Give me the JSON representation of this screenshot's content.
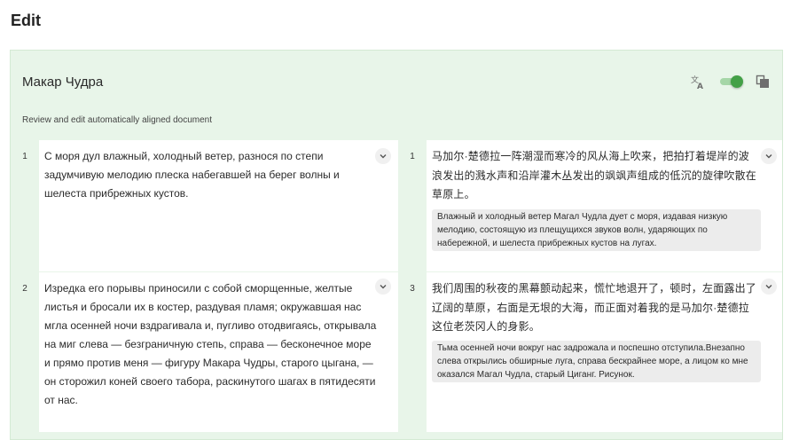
{
  "page": {
    "title": "Edit"
  },
  "document": {
    "title": "Макар Чудра",
    "subtitle": "Review and edit automatically aligned document"
  },
  "toolbar": {
    "translate_icon": "translate-icon",
    "toggle_state": "on",
    "copy_icon": "copy-icon",
    "accent_color": "#43a047"
  },
  "rows": [
    {
      "left_index": "1",
      "left_text": "С моря дул влажный, холодный ветер, разнося по степи задумчивую мелодию плеска набегавшей на берег волны и шелеста прибрежных кустов.",
      "right_index": "1",
      "right_text": "马加尔·楚德拉一阵潮湿而寒冷的风从海上吹来，把拍打着堤岸的波浪发出的溅水声和沿岸灌木丛发出的飒飒声组成的低沉的旋律吹散在草原上。",
      "right_translation": "Влажный и холодный ветер Магал Чудла дует с моря, издавая низкую мелодию, состоящую из плещущихся звуков волн, ударяющих по набережной, и шелеста прибрежных кустов на лугах."
    },
    {
      "left_index": "2",
      "left_text": "Изредка его порывы приносили с собой сморщенные, желтые листья и бросали их в костер, раздувая пламя; окружавшая нас мгла осенней ночи вздрагивала и, пугливо отодвигаясь, открывала на миг слева — безграничную степь, справа — бесконечное море и прямо против меня — фигуру Макара Чудры, старого цыгана, — он сторожил коней своего табора, раскинутого шагах в пятидесяти от нас.",
      "right_index": "3",
      "right_text": "我们周围的秋夜的黑幕颤动起来，慌忙地退开了，顿时，左面露出了辽阔的草原，右面是无垠的大海，而正面对着我的是马加尔·楚德拉这位老茨冈人的身影。",
      "right_translation": "Тьма осенней ночи вокруг нас задрожала и поспешно отступила.Внезапно слева открылись обширные луга, справа бескрайнее море, а лицом ко мне оказался Магал Чудла, старый Циганг. Рисунок."
    }
  ]
}
